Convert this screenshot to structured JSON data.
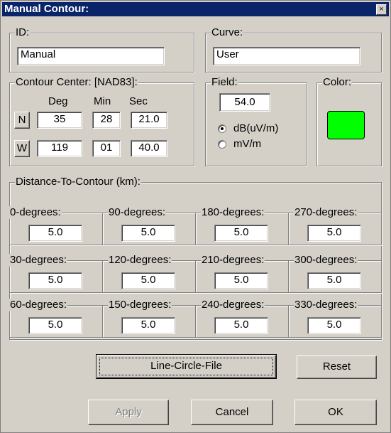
{
  "window": {
    "title": "Manual Contour:",
    "close_glyph": "×"
  },
  "id_group": {
    "label": "ID:",
    "value": "Manual"
  },
  "curve_group": {
    "label": "Curve:",
    "value": "User"
  },
  "center_group": {
    "label": "Contour Center: [NAD83]:",
    "col_deg": "Deg",
    "col_min": "Min",
    "col_sec": "Sec",
    "lat": {
      "hemisphere": "N",
      "deg": "35",
      "min": "28",
      "sec": "21.0"
    },
    "lon": {
      "hemisphere": "W",
      "deg": "119",
      "min": "01",
      "sec": "40.0"
    }
  },
  "field_group": {
    "label": "Field:",
    "value": "54.0",
    "options": [
      {
        "label": "dB(uV/m)",
        "selected": true
      },
      {
        "label": "mV/m",
        "selected": false
      }
    ]
  },
  "color_group": {
    "label": "Color:",
    "swatch_color": "#00ff00"
  },
  "distance_group": {
    "label": "Distance-To-Contour (km):",
    "rows": [
      [
        {
          "label": "0-degrees:",
          "value": "5.0"
        },
        {
          "label": "90-degrees:",
          "value": "5.0"
        },
        {
          "label": "180-degrees:",
          "value": "5.0"
        },
        {
          "label": "270-degrees:",
          "value": "5.0"
        }
      ],
      [
        {
          "label": "30-degrees:",
          "value": "5.0"
        },
        {
          "label": "120-degrees:",
          "value": "5.0"
        },
        {
          "label": "210-degrees:",
          "value": "5.0"
        },
        {
          "label": "300-degrees:",
          "value": "5.0"
        }
      ],
      [
        {
          "label": "60-degrees:",
          "value": "5.0"
        },
        {
          "label": "150-degrees:",
          "value": "5.0"
        },
        {
          "label": "240-degrees:",
          "value": "5.0"
        },
        {
          "label": "330-degrees:",
          "value": "5.0"
        }
      ]
    ]
  },
  "buttons": {
    "line_circle_file": "Line-Circle-File",
    "reset": "Reset",
    "apply": "Apply",
    "cancel": "Cancel",
    "ok": "OK"
  },
  "colors": {
    "titlebar": "#0a246a",
    "face": "#d4d0c8",
    "swatch": "#00ff00"
  }
}
